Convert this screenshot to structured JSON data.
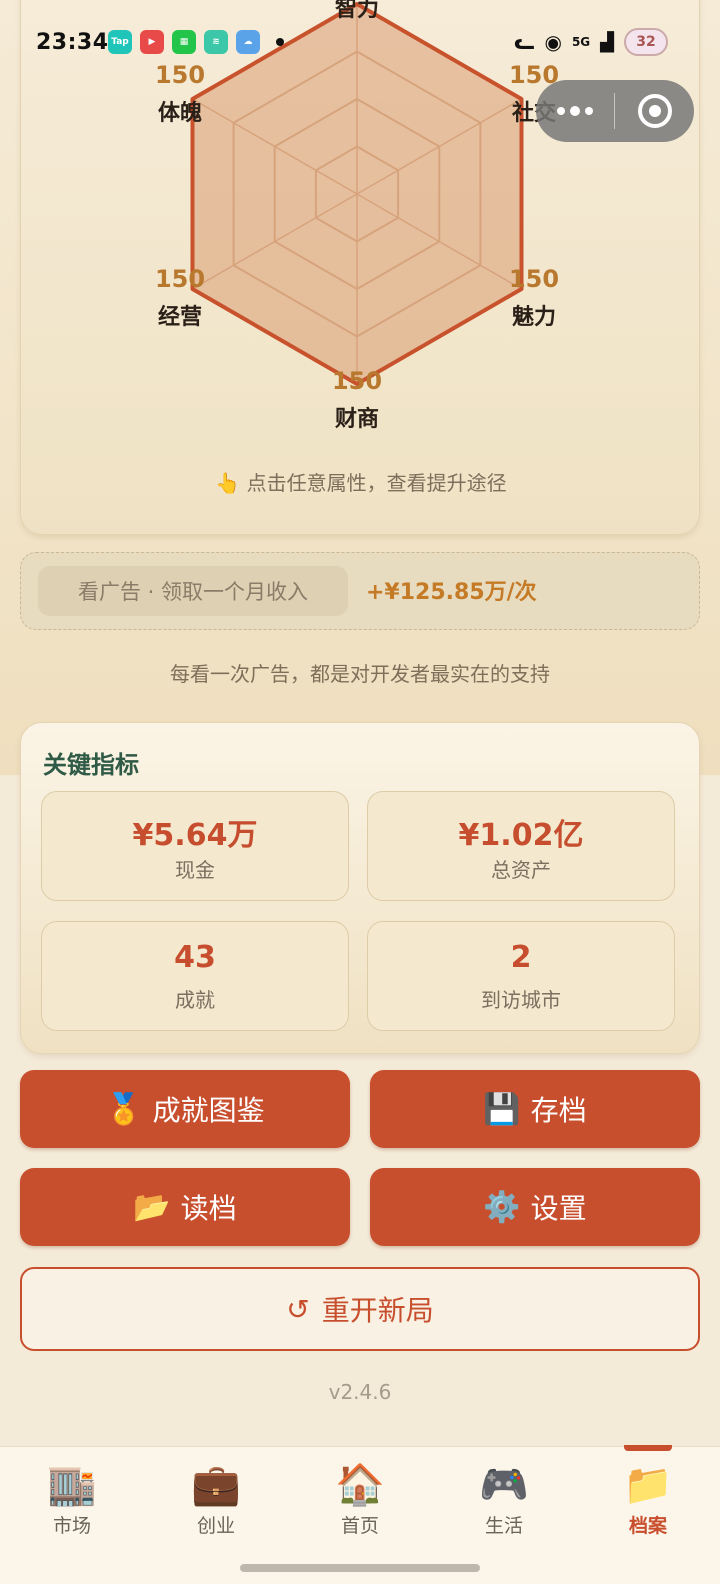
{
  "status_bar": {
    "time": "23:34",
    "network": "5G",
    "battery": "32",
    "app_icons": [
      "tap-icon",
      "video-icon",
      "grid-app-icon",
      "leaf-app-icon",
      "weather-icon"
    ]
  },
  "radar": {
    "attributes": [
      {
        "label": "智力",
        "value": "150"
      },
      {
        "label": "社交",
        "value": "150"
      },
      {
        "label": "魅力",
        "value": "150"
      },
      {
        "label": "财商",
        "value": "150"
      },
      {
        "label": "经营",
        "value": "150"
      },
      {
        "label": "体魄",
        "value": "150"
      }
    ],
    "hint_icon": "👆",
    "hint": "点击任意属性，查看提升途径"
  },
  "ad": {
    "button_label": "看广告 · 领取一个月收入",
    "amount": "+¥125.85万/次",
    "support_text": "每看一次广告，都是对开发者最实在的支持"
  },
  "metrics": {
    "title": "关键指标",
    "items": [
      {
        "value": "¥5.64万",
        "label": "现金"
      },
      {
        "value": "¥1.02亿",
        "label": "总资产"
      },
      {
        "value": "43",
        "label": "成就"
      },
      {
        "value": "2",
        "label": "到访城市"
      }
    ]
  },
  "actions": {
    "achievements": {
      "icon": "🏅",
      "label": "成就图鉴"
    },
    "save": {
      "icon": "💾",
      "label": "存档"
    },
    "load": {
      "icon": "📂",
      "label": "读档"
    },
    "settings": {
      "icon": "⚙️",
      "label": "设置"
    },
    "restart": {
      "icon": "↺",
      "label": "重开新局"
    }
  },
  "version": "v2.4.6",
  "tabs": [
    {
      "icon": "🏬",
      "label": "市场"
    },
    {
      "icon": "💼",
      "label": "创业"
    },
    {
      "icon": "🏠",
      "label": "首页"
    },
    {
      "icon": "🎮",
      "label": "生活"
    },
    {
      "icon": "📁",
      "label": "档案",
      "active": true
    }
  ],
  "colors": {
    "accent": "#c84f2e",
    "radar_fill": "#dca47c",
    "value_gold": "#b8782e",
    "title_green": "#2f5a46"
  }
}
